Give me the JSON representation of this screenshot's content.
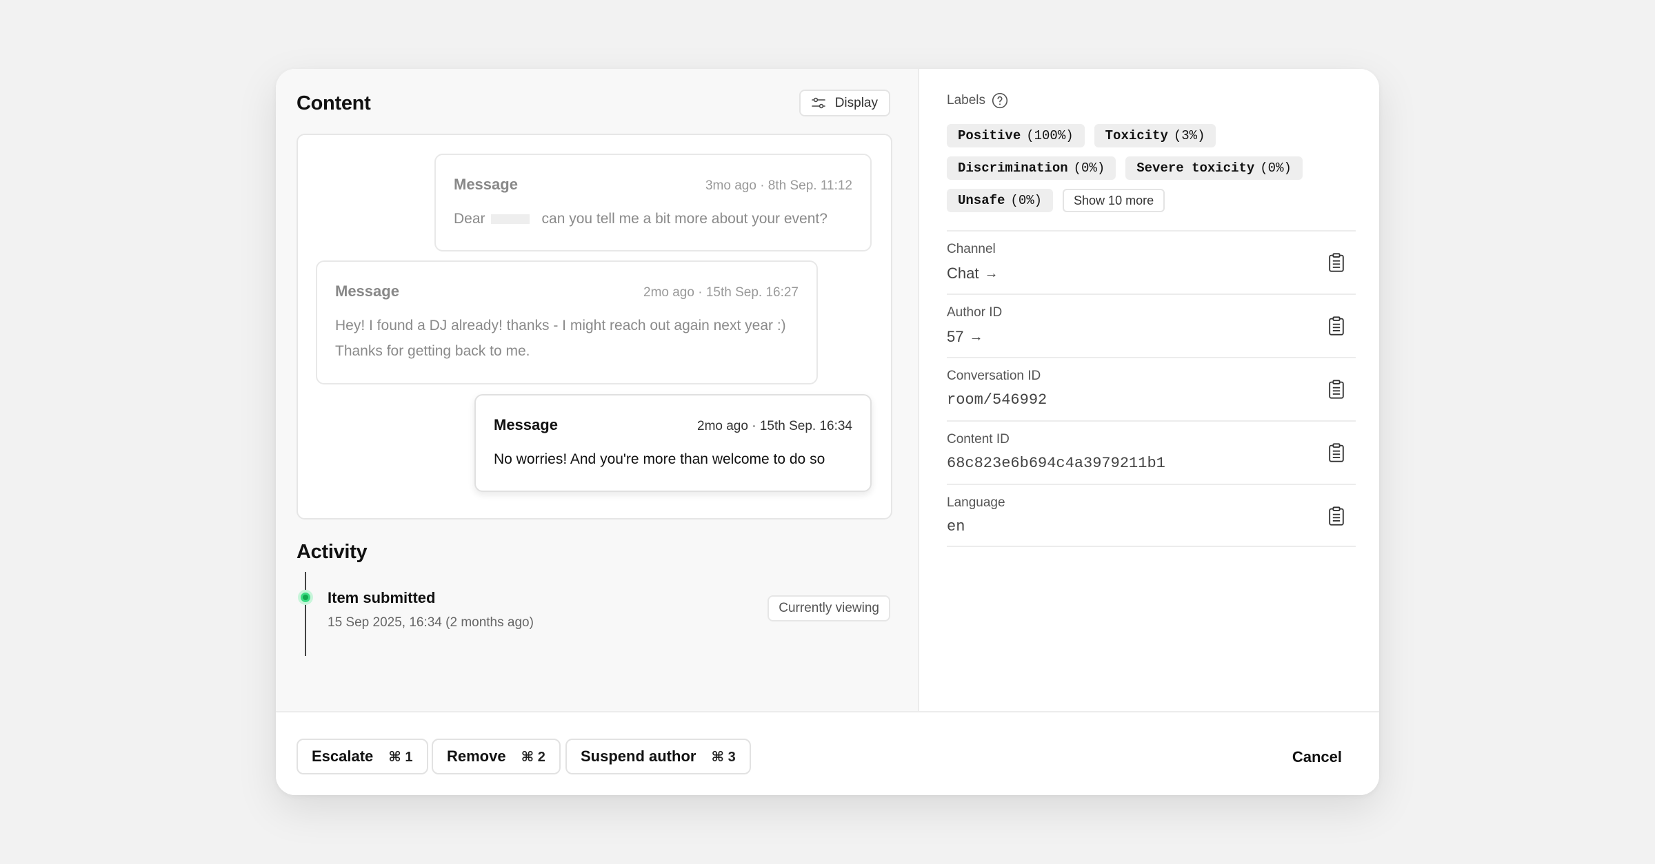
{
  "content": {
    "title": "Content",
    "display_label": "Display",
    "messages": [
      {
        "title": "Message",
        "time": "3mo ago · 8th Sep. 11:12",
        "body_prefix": "Dear",
        "body": "can you tell me a bit more about your event?"
      },
      {
        "title": "Message",
        "time": "2mo ago · 15th Sep. 16:27",
        "body": "Hey! I found a DJ already! thanks - I might reach out again next year :) Thanks for getting back to me."
      },
      {
        "title": "Message",
        "time": "2mo ago · 15th Sep. 16:34",
        "body": "No worries! And you're more than welcome to do so"
      }
    ]
  },
  "activity": {
    "title": "Activity",
    "event_title": "Item submitted",
    "event_time": "15 Sep 2025, 16:34 (2 months ago)",
    "badge": "Currently viewing",
    "dot_color": "#3ddc84"
  },
  "labels": {
    "title": "Labels",
    "chips": [
      {
        "name": "Positive",
        "pct": "(100%)"
      },
      {
        "name": "Toxicity",
        "pct": "(3%)"
      },
      {
        "name": "Discrimination",
        "pct": "(0%)"
      },
      {
        "name": "Severe toxicity",
        "pct": "(0%)"
      },
      {
        "name": "Unsafe",
        "pct": "(0%)"
      }
    ],
    "more": "Show 10 more"
  },
  "fields": [
    {
      "label": "Channel",
      "value": "Chat",
      "arrow": "→"
    },
    {
      "label": "Author ID",
      "value": "57",
      "arrow": "→"
    },
    {
      "label": "Conversation ID",
      "value": "room/546992"
    },
    {
      "label": "Content ID",
      "value": "68c823e6b694c4a3979211b1"
    },
    {
      "label": "Language",
      "value": "en"
    }
  ],
  "footer": {
    "escalate": "Escalate",
    "escalate_kbd": "⌘ 1",
    "remove": "Remove",
    "remove_kbd": "⌘ 2",
    "suspend": "Suspend author",
    "suspend_kbd": "⌘ 3",
    "cancel": "Cancel"
  }
}
